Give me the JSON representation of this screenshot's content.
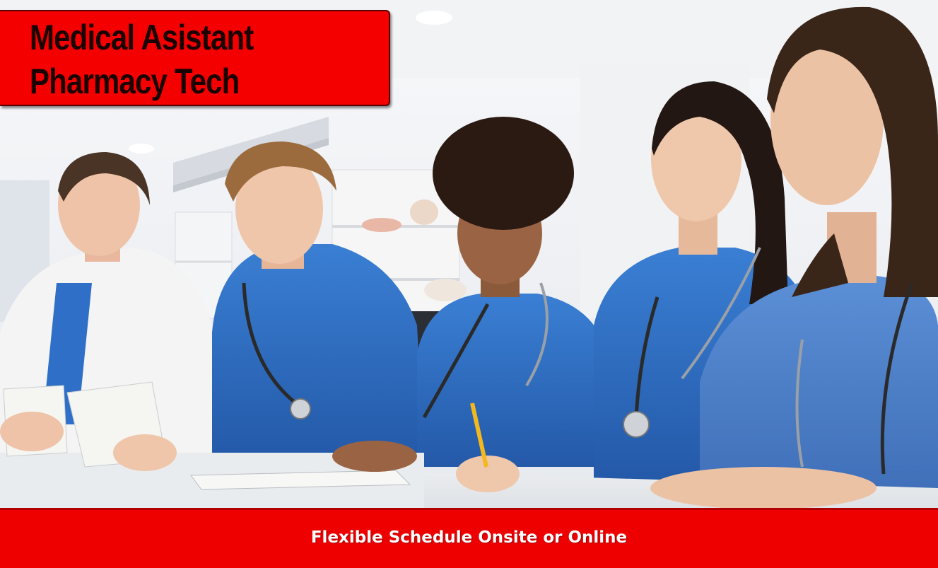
{
  "banner": {
    "title_lines": [
      "Medical Asistant",
      "Pharmacy Tech"
    ],
    "tagline": "Flexible Schedule Onsite or Online"
  },
  "colors": {
    "banner_red": "#f40000",
    "footer_red": "#ee0000",
    "scrub_blue": "#2f6fc8",
    "title_text": "#1a0000",
    "tagline_text": "#ffffff"
  }
}
